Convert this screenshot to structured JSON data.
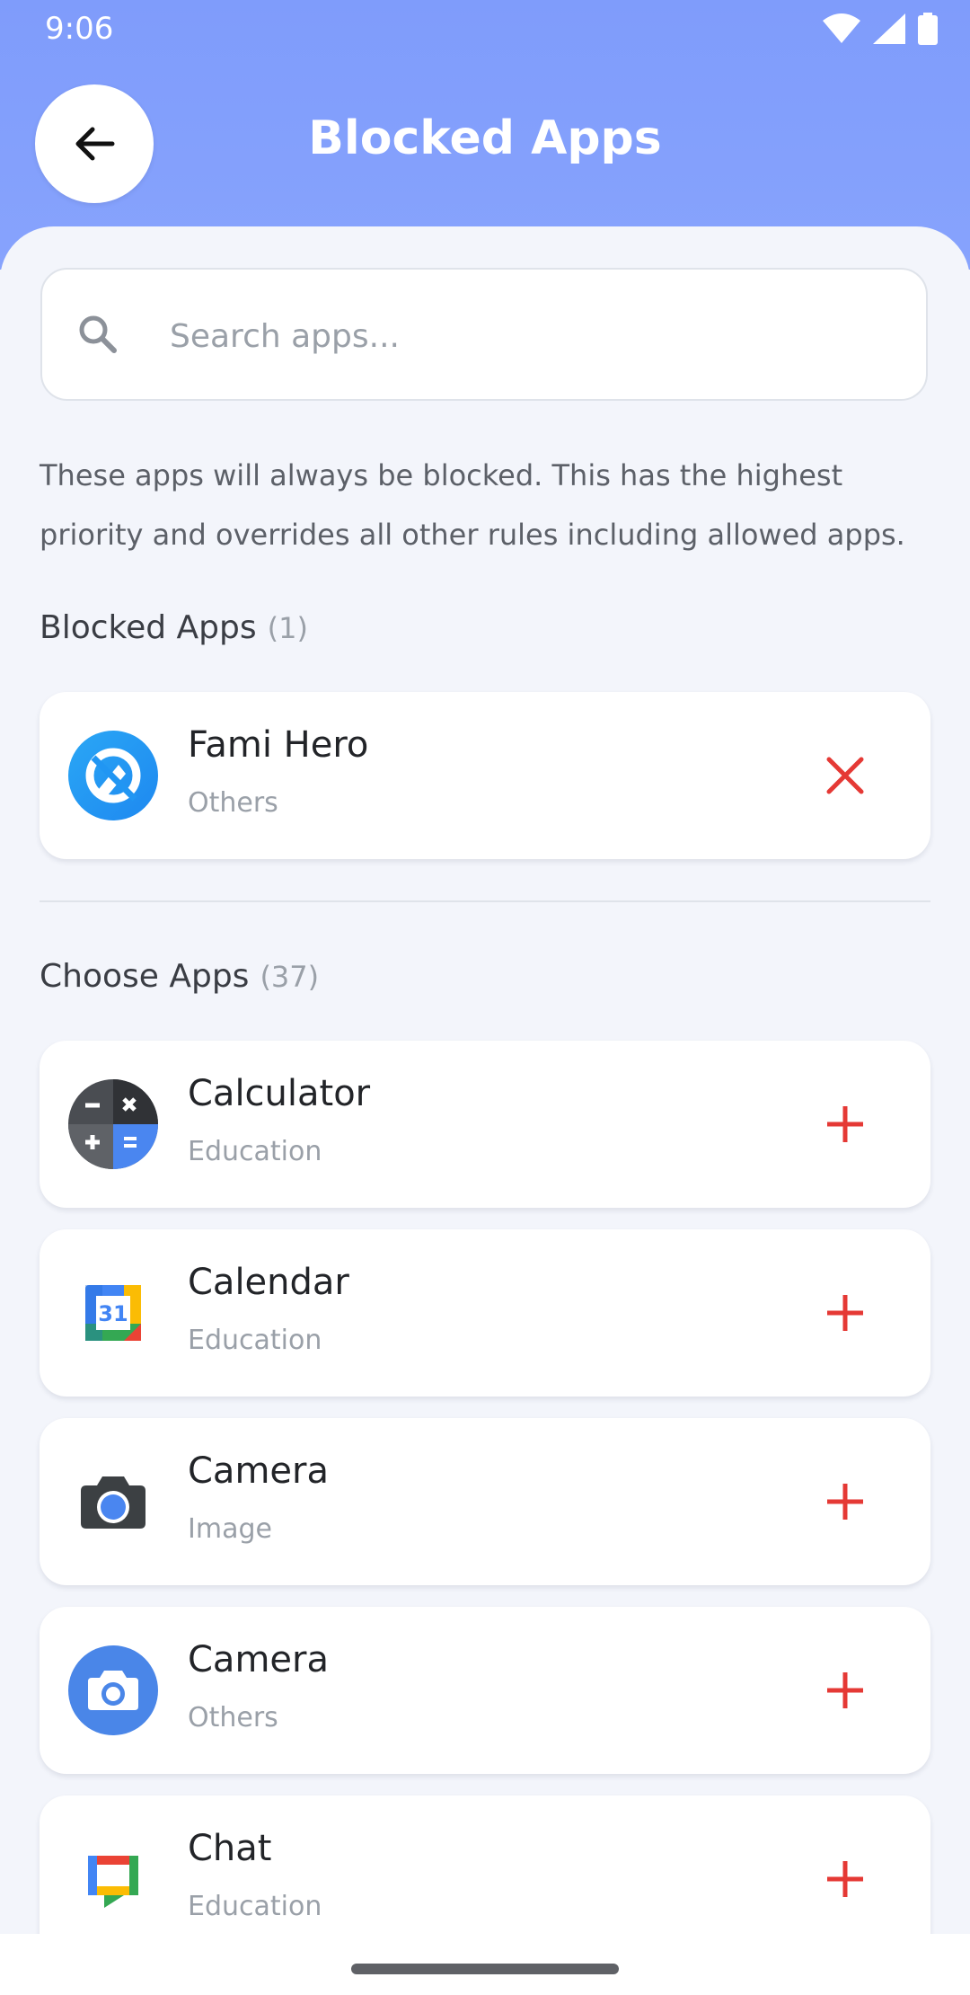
{
  "status_bar": {
    "time": "9:06",
    "icons": [
      "wifi-icon",
      "signal-icon",
      "battery-icon"
    ]
  },
  "header": {
    "title": "Blocked Apps",
    "back_icon": "arrow-left-icon"
  },
  "search": {
    "placeholder": "Search apps...",
    "value": ""
  },
  "description": "These apps will always be blocked. This has the highest priority and overrides all other rules including allowed apps.",
  "blocked_section": {
    "title": "Blocked Apps",
    "count": "(1)",
    "items": [
      {
        "name": "Fami Hero",
        "category": "Others",
        "icon": "fami-hero-icon",
        "action": "remove-icon"
      }
    ]
  },
  "choose_section": {
    "title": "Choose Apps",
    "count": "(37)",
    "items": [
      {
        "name": "Calculator",
        "category": "Education",
        "icon": "calculator-icon",
        "action": "add-icon"
      },
      {
        "name": "Calendar",
        "category": "Education",
        "icon": "calendar-icon",
        "calendar_day": "31",
        "action": "add-icon"
      },
      {
        "name": "Camera",
        "category": "Image",
        "icon": "camera-icon",
        "action": "add-icon"
      },
      {
        "name": "Camera",
        "category": "Others",
        "icon": "camera-round-icon",
        "action": "add-icon"
      },
      {
        "name": "Chat",
        "category": "Education",
        "icon": "chat-icon",
        "action": "add-icon"
      }
    ]
  },
  "colors": {
    "header": "#829ffc",
    "danger": "#e53935",
    "background": "#f3f5fb"
  }
}
